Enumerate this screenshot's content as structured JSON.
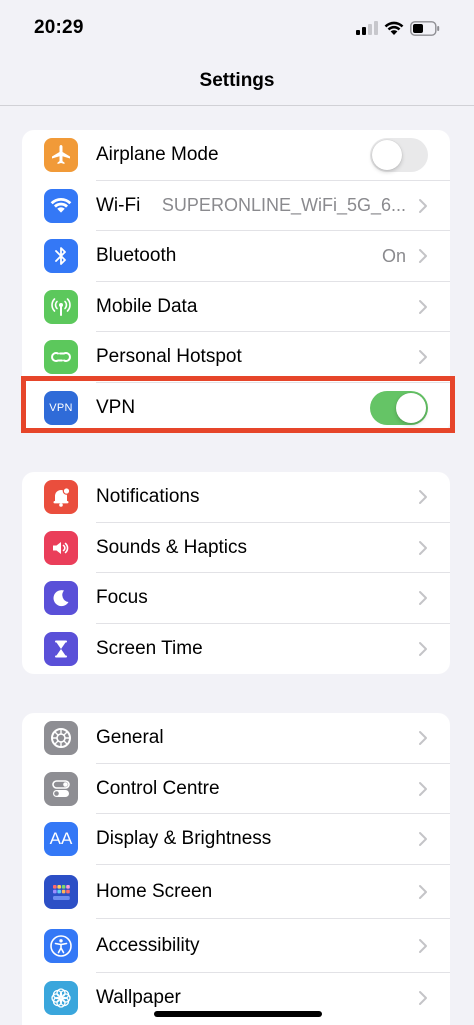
{
  "status_bar": {
    "time": "20:29"
  },
  "nav": {
    "title": "Settings"
  },
  "groups": [
    {
      "items": [
        {
          "label": "Airplane Mode",
          "icon": "airplane-icon",
          "color": "#f19a38",
          "accessory": "toggle",
          "toggle_on": false
        },
        {
          "label": "Wi-Fi",
          "icon": "wifi-icon",
          "color": "#3478f6",
          "accessory": "chevron",
          "value": "SUPERONLINE_WiFi_5G_6..."
        },
        {
          "label": "Bluetooth",
          "icon": "bluetooth-icon",
          "color": "#3478f6",
          "accessory": "chevron",
          "value": "On"
        },
        {
          "label": "Mobile Data",
          "icon": "antenna-icon",
          "color": "#5cc85c",
          "accessory": "chevron"
        },
        {
          "label": "Personal Hotspot",
          "icon": "hotspot-icon",
          "color": "#5cc85c",
          "accessory": "chevron"
        },
        {
          "label": "VPN",
          "icon": "vpn-icon",
          "icon_text": "VPN",
          "color": "#2f6bd8",
          "accessory": "toggle",
          "toggle_on": true
        }
      ]
    },
    {
      "items": [
        {
          "label": "Notifications",
          "icon": "bell-icon",
          "color": "#ea4e3d"
        },
        {
          "label": "Sounds & Haptics",
          "icon": "speaker-icon",
          "color": "#ea3e5a"
        },
        {
          "label": "Focus",
          "icon": "moon-icon",
          "color": "#5a50d8"
        },
        {
          "label": "Screen Time",
          "icon": "hourglass-icon",
          "color": "#5a50d8"
        }
      ]
    },
    {
      "items": [
        {
          "label": "General",
          "icon": "gear-icon",
          "color": "#8e8e93"
        },
        {
          "label": "Control Centre",
          "icon": "switches-icon",
          "color": "#8e8e93"
        },
        {
          "label": "Display & Brightness",
          "icon": "text-size-icon",
          "icon_text": "AA",
          "color": "#3478f6"
        },
        {
          "label": "Home Screen",
          "icon": "home-grid-icon",
          "color": "#2c4fc6"
        },
        {
          "label": "Accessibility",
          "icon": "accessibility-icon",
          "color": "#3478f6"
        },
        {
          "label": "Wallpaper",
          "icon": "flower-icon",
          "color": "#3aa6dc"
        }
      ]
    }
  ]
}
